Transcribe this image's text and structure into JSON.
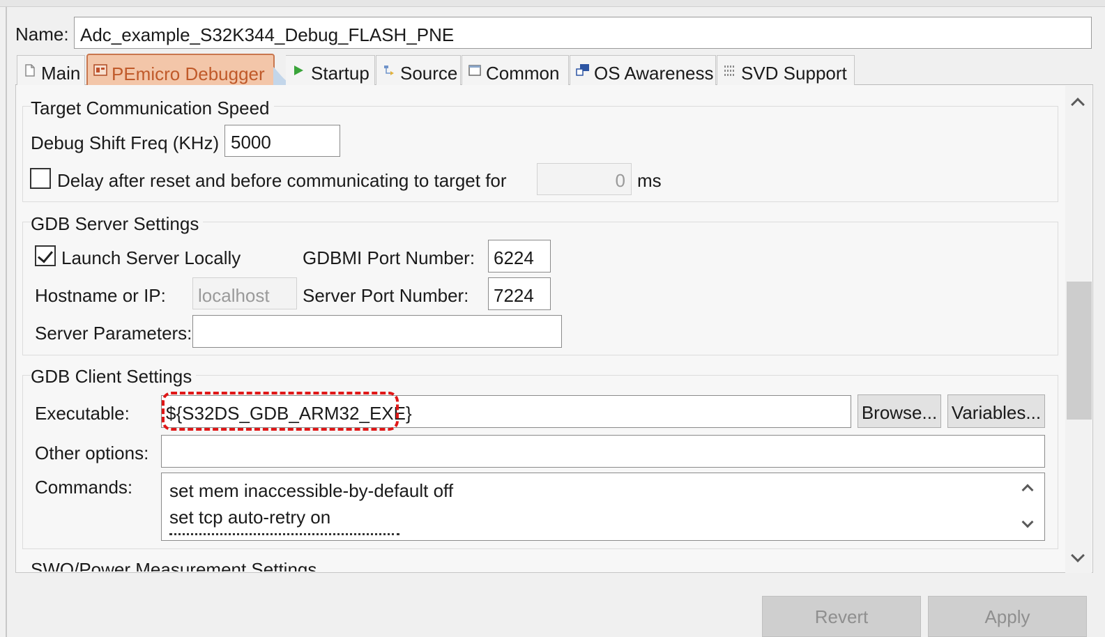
{
  "name": {
    "label": "Name:",
    "value": "Adc_example_S32K344_Debug_FLASH_PNE"
  },
  "tabs": [
    {
      "label": "Main",
      "icon": "document-icon"
    },
    {
      "label": "PEmicro Debugger",
      "icon": "debugger-icon",
      "selected": true
    },
    {
      "label": "Startup",
      "icon": "play-icon"
    },
    {
      "label": "Source",
      "icon": "source-icon"
    },
    {
      "label": "Common",
      "icon": "window-icon"
    },
    {
      "label": "OS Awareness",
      "icon": "os-icon"
    },
    {
      "label": "SVD Support",
      "icon": "register-icon"
    }
  ],
  "target_comm": {
    "title": "Target Communication Speed",
    "shift_label": "Debug Shift Freq (KHz)",
    "shift_value": "5000",
    "delay_label": "Delay after reset and before communicating to target for",
    "delay_value": "0",
    "delay_unit": "ms",
    "delay_checked": false
  },
  "gdb_server": {
    "title": "GDB Server Settings",
    "launch_label": "Launch Server Locally",
    "launch_checked": true,
    "gdbmi_label": "GDBMI Port Number:",
    "gdbmi_value": "6224",
    "hostname_label": "Hostname or IP:",
    "hostname_value": "localhost",
    "server_port_label": "Server Port Number:",
    "server_port_value": "7224",
    "params_label": "Server Parameters:",
    "params_value": ""
  },
  "gdb_client": {
    "title": "GDB Client Settings",
    "exe_label": "Executable:",
    "exe_value": "${S32DS_GDB_ARM32_EXE}",
    "browse_label": "Browse...",
    "variables_label": "Variables...",
    "other_label": "Other options:",
    "other_value": "",
    "commands_label": "Commands:",
    "commands": [
      "set mem inaccessible-by-default off",
      "set tcp auto-retry on"
    ]
  },
  "swo": {
    "title": "SWO/Power Measurement Settings"
  },
  "footer": {
    "revert_label": "Revert",
    "apply_label": "Apply"
  },
  "colors": {
    "selected_tab_bg": "#f3c6a9",
    "selected_tab_text": "#c05a2a",
    "highlight": "#e01818"
  }
}
